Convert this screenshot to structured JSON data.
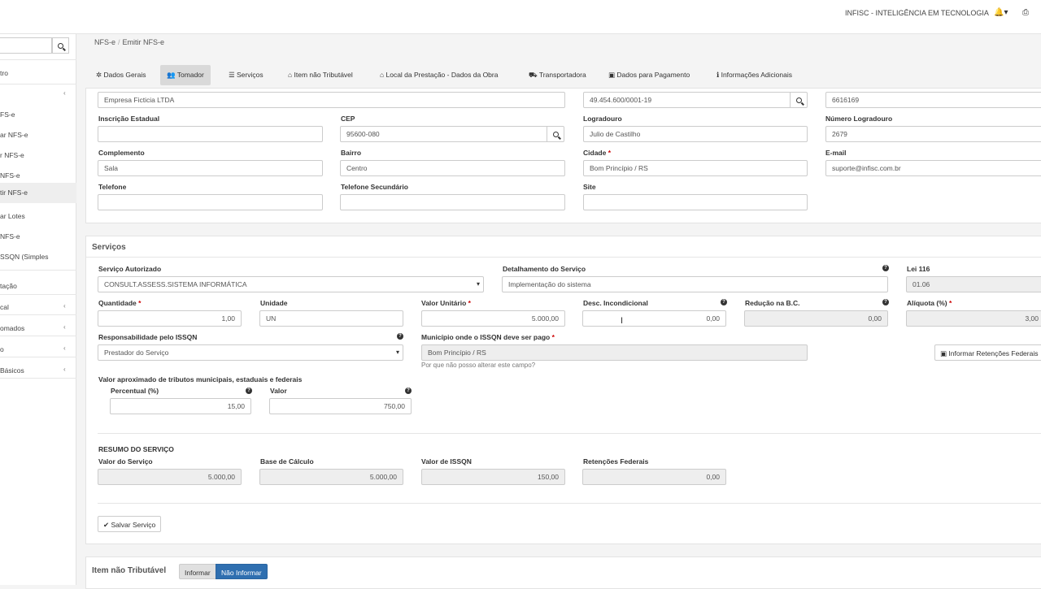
{
  "header": {
    "brand": "INFISC - INTELIGÊNCIA EM TECNOLOGIA",
    "bell": "🔔▾",
    "print": "⎙"
  },
  "sidebar": {
    "items": [
      {
        "label": "tro"
      },
      {
        "label": "FS-e"
      },
      {
        "label": "ar NFS-e"
      },
      {
        "label": "r NFS-e"
      },
      {
        "label": "NFS-e"
      },
      {
        "label": "tir NFS-e"
      },
      {
        "label": "ar Lotes"
      },
      {
        "label": " NFS-e"
      },
      {
        "label": "SSQN (Simples"
      },
      {
        "label": "tação"
      },
      {
        "label": "cal"
      },
      {
        "label": "omados"
      },
      {
        "label": "o"
      },
      {
        "label": "Básicos"
      }
    ]
  },
  "breadcrumb": {
    "first": "NFS-e",
    "second": "Emitir NFS-e"
  },
  "tabs": {
    "t1": "Dados Gerais",
    "t2": "Tomador",
    "t3": "Serviços",
    "t4": "Item não Tributável",
    "t5": "Local da Prestação - Dados da Obra",
    "t6": "Transportadora",
    "t7": "Dados para Pagamento",
    "t8": "Informações Adicionais"
  },
  "tomador": {
    "razao_social": "Empresa Ficticia LTDA",
    "cnpj": "49.454.600/0001-19",
    "codigo": "6616169",
    "inscricao_label": "Inscrição Estadual",
    "inscricao": "",
    "cep_label": "CEP",
    "cep": "95600-080",
    "logradouro_label": "Logradouro",
    "logradouro": "Julio de Castilho",
    "numero_label": "Número Logradouro",
    "numero": "2679",
    "complemento_label": "Complemento",
    "complemento": "Sala",
    "bairro_label": "Bairro",
    "bairro": "Centro",
    "cidade_label": "Cidade",
    "cidade": "Bom Princípio / RS",
    "email_label": "E-mail",
    "email": "suporte@infisc.com.br",
    "telefone_label": "Telefone",
    "telefone": "",
    "telefone2_label": "Telefone Secundário",
    "telefone2": "",
    "site_label": "Site",
    "site": ""
  },
  "servicos": {
    "title": "Serviços",
    "servico_label": "Serviço Autorizado",
    "servico": "CONSULT.ASSESS.SISTEMA INFORMÁTICA",
    "detalhamento_label": "Detalhamento do Serviço",
    "detalhamento": "Implementação do sistema",
    "lei_label": "Lei 116",
    "lei": "01.06",
    "quantidade_label": "Quantidade",
    "quantidade": "1,00",
    "unidade_label": "Unidade",
    "unidade": "UN",
    "valor_unit_label": "Valor Unitário",
    "valor_unit": "5.000,00",
    "desc_label": "Desc. Incondicional",
    "desc": "0,00",
    "reducao_label": "Redução na B.C.",
    "reducao": "0,00",
    "aliquota_label": "Alíquota (%)",
    "aliquota": "3,00",
    "resp_label": "Responsabilidade pelo ISSQN",
    "resp": "Prestador do Serviço",
    "municipio_label": "Município onde o ISSQN deve ser pago",
    "municipio": "Bom Princípio / RS",
    "municipio_hint": "Por que não posso alterar este campo?",
    "retencoes_btn": "Informar Retenções Federais",
    "tributos_label": "Valor aproximado de tributos municipais, estaduais e federais",
    "percentual_label": "Percentual (%)",
    "percentual": "15,00",
    "valor_label": "Valor",
    "valor": "750,00"
  },
  "resumo": {
    "title": "RESUMO DO SERVIÇO",
    "valor_servico_label": "Valor do Serviço",
    "valor_servico": "5.000,00",
    "base_label": "Base de Cálculo",
    "base": "5.000,00",
    "issqn_label": "Valor de ISSQN",
    "issqn": "150,00",
    "retencoes_label": "Retenções Federais",
    "retencoes": "0,00"
  },
  "salvar_label": "Salvar Serviço",
  "item_nao_trib": {
    "title": "Item não Tributável",
    "informar": "Informar",
    "nao_informar": "Não Informar"
  }
}
